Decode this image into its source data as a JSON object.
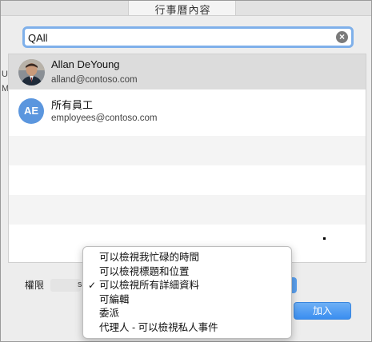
{
  "window": {
    "title": "行事曆內容"
  },
  "search": {
    "value": "QAll"
  },
  "results": [
    {
      "name": "Allan DeYoung",
      "email": "alland@contoso.com"
    },
    {
      "name": "所有員工",
      "email": "employees@contoso.com",
      "initials": "AE"
    }
  ],
  "background_fragments": {
    "left_a": "U",
    "left_b": "M",
    "s": "s"
  },
  "permissions": {
    "label": "權限",
    "options": [
      "可以檢視我忙碌的時間",
      "可以檢視標題和位置",
      "可以檢視所有詳細資料",
      "可編輯",
      "委派",
      "代理人 - 可以檢視私人事件"
    ],
    "selected_index": 2
  },
  "add_button": {
    "label": "加入"
  },
  "colors": {
    "accent": "#5b96de",
    "search_focus": "#7fb0ea",
    "button": "#3a8ef0"
  },
  "icons": {
    "clear": "clear-circle-icon",
    "check": "checkmark-icon"
  }
}
